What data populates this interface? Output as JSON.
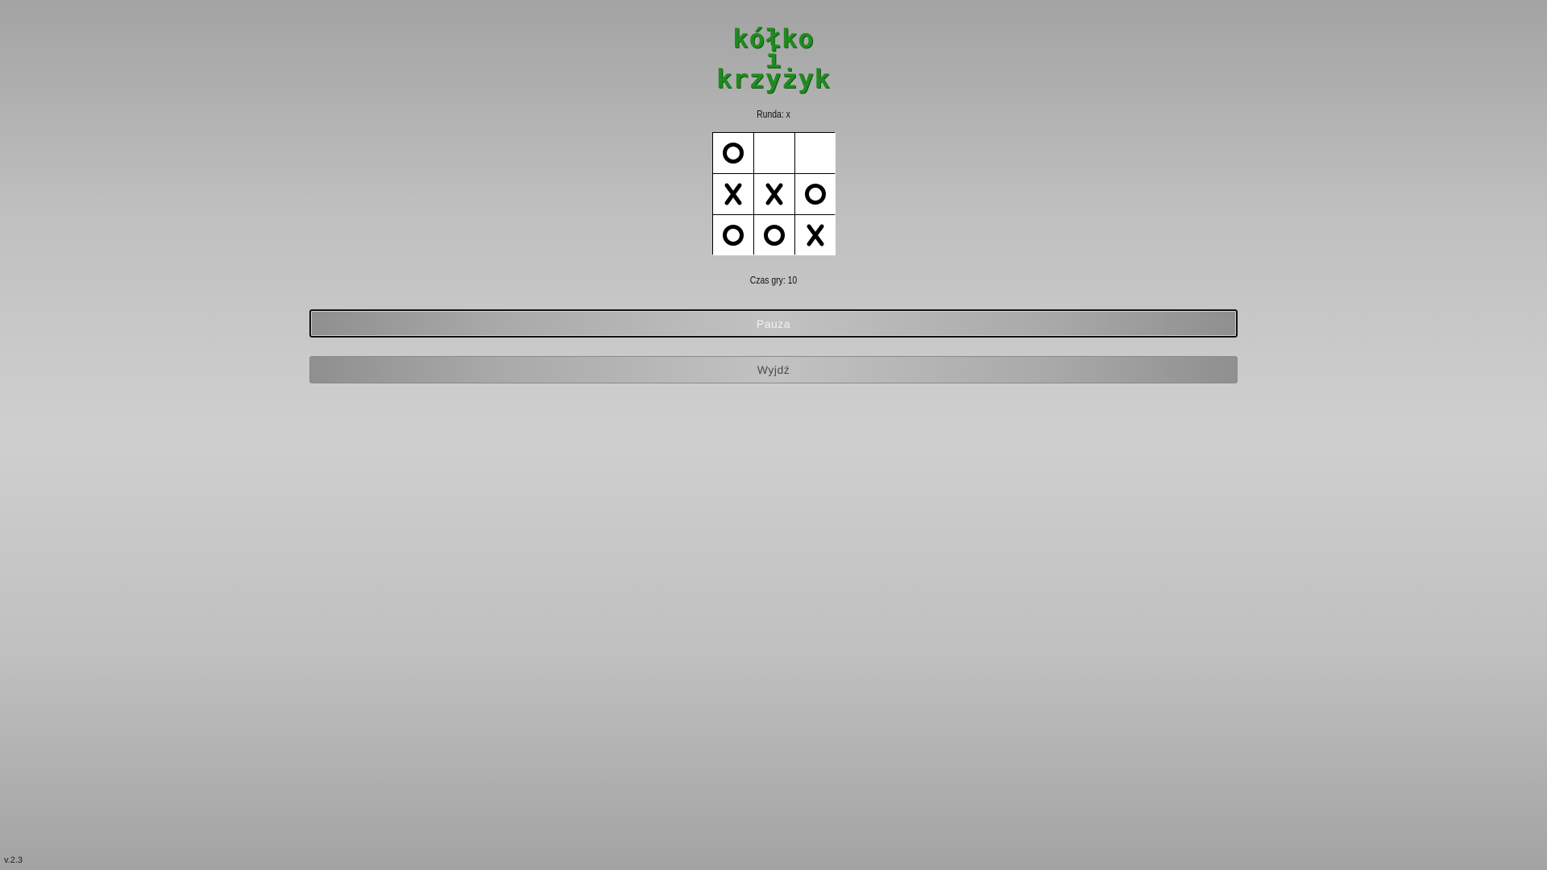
{
  "title": {
    "line1": "kółko",
    "line2": "i",
    "line3": "krzyżyk"
  },
  "round_label": "Runda: x",
  "board": {
    "cells": [
      "O",
      "",
      "",
      "X",
      "X",
      "O",
      "O",
      "O",
      "X"
    ]
  },
  "time_label": "Czas gry: 10",
  "buttons": {
    "pause": "Pauza",
    "exit": "Wyjdź"
  },
  "version": "v.2.3",
  "colors": {
    "title": "#1f8a1f",
    "mark": "#000000",
    "cell_bg": "#ffffff"
  }
}
